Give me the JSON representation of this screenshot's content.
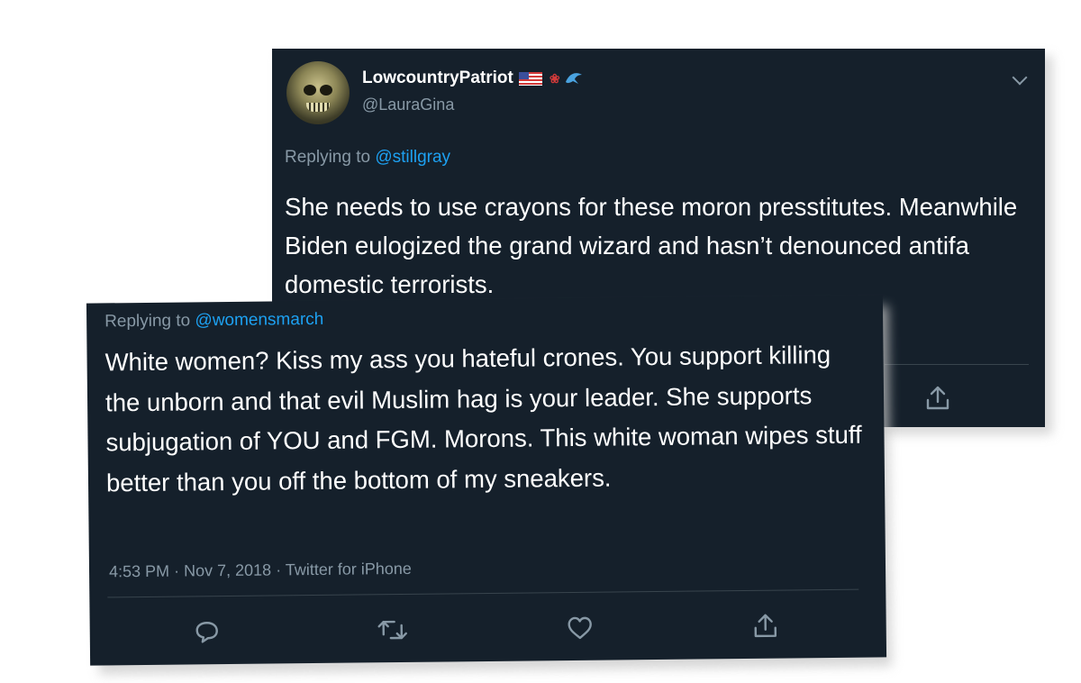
{
  "back_tweet": {
    "display_name": "LowcountryPatriot",
    "name_icons": [
      "us-flag-icon",
      "paw-prints-icon",
      "dolphin-icon"
    ],
    "handle": "@LauraGina",
    "replying_prefix": "Replying to",
    "replying_to": "@stillgray",
    "text": "She needs to use crayons for these moron presstitutes. Meanwhile Biden eulogized the grand wizard and hasn’t denounced antifa domestic terrorists.",
    "visible_actions": [
      "share-icon"
    ]
  },
  "front_tweet": {
    "replying_prefix": "Replying to",
    "replying_to": "@womensmarch",
    "text": "White women? Kiss my ass you hateful crones. You support killing the unborn and that evil Muslim hag is your leader. She supports subjugation of YOU and FGM. Morons. This white woman wipes stuff better than you off the bottom of my sneakers.",
    "timestamp": "4:53 PM · Nov 7, 2018 · Twitter for iPhone",
    "actions": [
      "reply-icon",
      "retweet-icon",
      "like-icon",
      "share-icon"
    ]
  },
  "colors": {
    "card_bg": "#15202b",
    "text": "#ffffff",
    "muted": "#8899a6",
    "link": "#1da1f2",
    "divider": "#38444d"
  }
}
